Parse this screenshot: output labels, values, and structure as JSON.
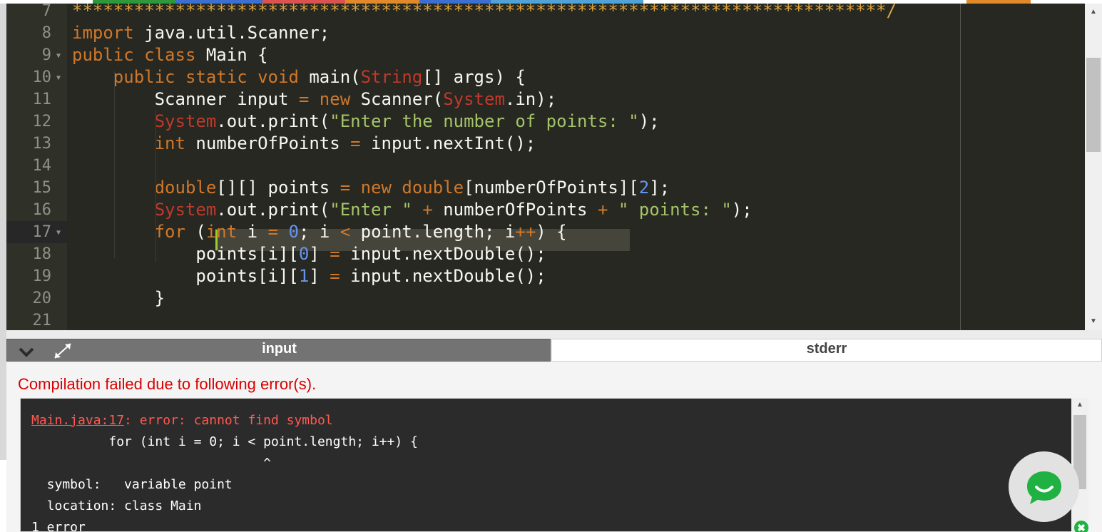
{
  "colors": {
    "editor_bg": "#272822",
    "gutter_bg": "#2f3129",
    "error_red": "#d90000",
    "tab_active": "#737373",
    "chat_green": "#1fb141"
  },
  "topstrip_colors": [
    "#ffffff",
    "#2c9a3b",
    "#2c9a3b",
    "#3b6fd1",
    "#3b6fd1",
    "#d9534f",
    "#d9534f",
    "#e08a2c",
    "#3b6fd1",
    "#4fa3d9",
    "#4fa3d9",
    "#ffffff",
    "#ffffff",
    "#ffffff",
    "#e08a2c",
    "#e08a2c"
  ],
  "editor": {
    "lines": [
      {
        "n": "7",
        "text": "*******************************************************************************/",
        "fold": false
      },
      {
        "n": "8",
        "text": "import java.util.Scanner;",
        "fold": false
      },
      {
        "n": "9",
        "text": "public class Main {",
        "fold": true
      },
      {
        "n": "10",
        "text": "    public static void main(String[] args) {",
        "fold": true
      },
      {
        "n": "11",
        "text": "        Scanner input = new Scanner(System.in);",
        "fold": false
      },
      {
        "n": "12",
        "text": "        System.out.print(\"Enter the number of points: \");",
        "fold": false
      },
      {
        "n": "13",
        "text": "        int numberOfPoints = input.nextInt();",
        "fold": false
      },
      {
        "n": "14",
        "text": "",
        "fold": false
      },
      {
        "n": "15",
        "text": "        double[][] points = new double[numberOfPoints][2];",
        "fold": false
      },
      {
        "n": "16",
        "text": "        System.out.print(\"Enter \" + numberOfPoints + \" points: \");",
        "fold": false
      },
      {
        "n": "17",
        "text": "        for (int i = 0; i < point.length; i++) {",
        "fold": true
      },
      {
        "n": "18",
        "text": "            points[i][0] = input.nextDouble();",
        "fold": false
      },
      {
        "n": "19",
        "text": "            points[i][1] = input.nextDouble();",
        "fold": false
      },
      {
        "n": "20",
        "text": "        }",
        "fold": false
      },
      {
        "n": "21",
        "text": "",
        "fold": false
      }
    ]
  },
  "tabs": {
    "input_label": "input",
    "stderr_label": "stderr"
  },
  "output": {
    "error_title": "Compilation failed due to following error(s).",
    "err_location": "Main.java:17",
    "err_message": ": error: cannot find symbol",
    "err_code_line": "          for (int i = 0; i < point.length; i++) {",
    "err_caret_line": "                              ^",
    "symbol_line": "  symbol:   variable point",
    "location_line": "  location: class Main",
    "count_line": "1 error"
  },
  "icons": {
    "collapse": "chevron-down-icon",
    "expand": "expand-arrows-icon",
    "chat": "chat-bubble-icon",
    "badge": "close-badge-icon"
  },
  "badge_text": "✖"
}
